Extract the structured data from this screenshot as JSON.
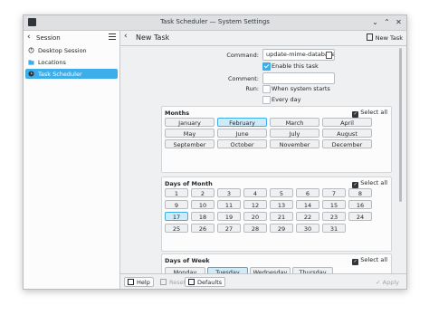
{
  "window": {
    "title": "Task Scheduler — System Settings"
  },
  "sidebar": {
    "title": "Session",
    "items": [
      {
        "label": "Desktop Session",
        "icon": "power-icon"
      },
      {
        "label": "Locations",
        "icon": "folder-icon"
      },
      {
        "label": "Task Scheduler",
        "icon": "clock-icon",
        "selected": true
      }
    ]
  },
  "main": {
    "title": "New Task",
    "new_task_label": "New Task",
    "command_label": "Command:",
    "command_value": "update-mime-database",
    "enable_label": "Enable this task",
    "enable_checked": true,
    "comment_label": "Comment:",
    "comment_value": "",
    "run_label": "Run:",
    "run_startup_label": "When system starts",
    "run_everyday_label": "Every day"
  },
  "months": {
    "title": "Months",
    "select_all": "Select all",
    "items": [
      "January",
      "February",
      "March",
      "April",
      "May",
      "June",
      "July",
      "August",
      "September",
      "October",
      "November",
      "December"
    ],
    "selected": "February"
  },
  "days_of_month": {
    "title": "Days of Month",
    "select_all": "Select all",
    "items": [
      "1",
      "2",
      "3",
      "4",
      "5",
      "6",
      "7",
      "8",
      "9",
      "10",
      "11",
      "12",
      "13",
      "14",
      "15",
      "16",
      "17",
      "18",
      "19",
      "20",
      "21",
      "22",
      "23",
      "24",
      "25",
      "26",
      "27",
      "28",
      "29",
      "30",
      "31"
    ],
    "selected": "17"
  },
  "days_of_week": {
    "title": "Days of Week",
    "select_all": "Select all",
    "items": [
      "Monday",
      "Tuesday",
      "Wednesday",
      "Thursday"
    ],
    "selected": "Tuesday"
  },
  "footer": {
    "help": "Help",
    "reset": "Reset",
    "defaults": "Defaults",
    "apply": "Apply"
  },
  "colors": {
    "accent": "#3daee9",
    "selected_bg": "#cfeaf9"
  }
}
